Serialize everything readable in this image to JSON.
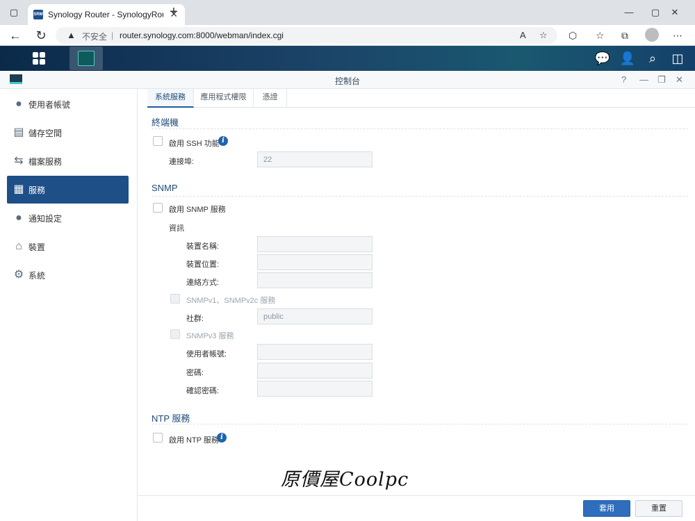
{
  "browser": {
    "tab_title": "Synology Router - SynologyRouter",
    "tab_favicon": "SRM",
    "insecure_label": "不安全",
    "url": "router.synology.com:8000/webman/index.cgi"
  },
  "window": {
    "title": "控制台"
  },
  "sidebar": {
    "items": [
      {
        "label": "使用者帳號",
        "icon": "user-icon"
      },
      {
        "label": "儲存空間",
        "icon": "database-icon"
      },
      {
        "label": "檔案服務",
        "icon": "file-transfer-icon"
      },
      {
        "label": "服務",
        "icon": "grid-icon",
        "active": true
      },
      {
        "label": "通知設定",
        "icon": "chat-bubble-icon"
      },
      {
        "label": "裝置",
        "icon": "router-icon"
      },
      {
        "label": "系統",
        "icon": "gear-icon"
      }
    ]
  },
  "tabs": [
    "系統服務",
    "應用程式權限",
    "憑證"
  ],
  "terminal": {
    "title": "終端機",
    "ssh_label": "啟用 SSH 功能",
    "port_label": "連接埠:",
    "port_value": "22"
  },
  "snmp": {
    "title": "SNMP",
    "enable_label": "啟用 SNMP 服務",
    "info_label": "資訊",
    "device_name_label": "裝置名稱:",
    "device_location_label": "裝置位置:",
    "contact_label": "連絡方式:",
    "v1v2_label": "SNMPv1、SNMPv2c 服務",
    "community_label": "社群:",
    "community_value": "public",
    "v3_label": "SNMPv3 服務",
    "username_label": "使用者帳號:",
    "password_label": "密碼:",
    "confirm_password_label": "確認密碼:"
  },
  "ntp": {
    "title": "NTP 服務",
    "enable_label": "啟用 NTP 服務"
  },
  "footer": {
    "apply_label": "套用",
    "reset_label": "重置"
  },
  "watermark": "原價屋Coolpc",
  "colors": {
    "accent": "#1e4f87",
    "apply_button": "#2f6dbd",
    "section_title": "#1d4a7a"
  }
}
